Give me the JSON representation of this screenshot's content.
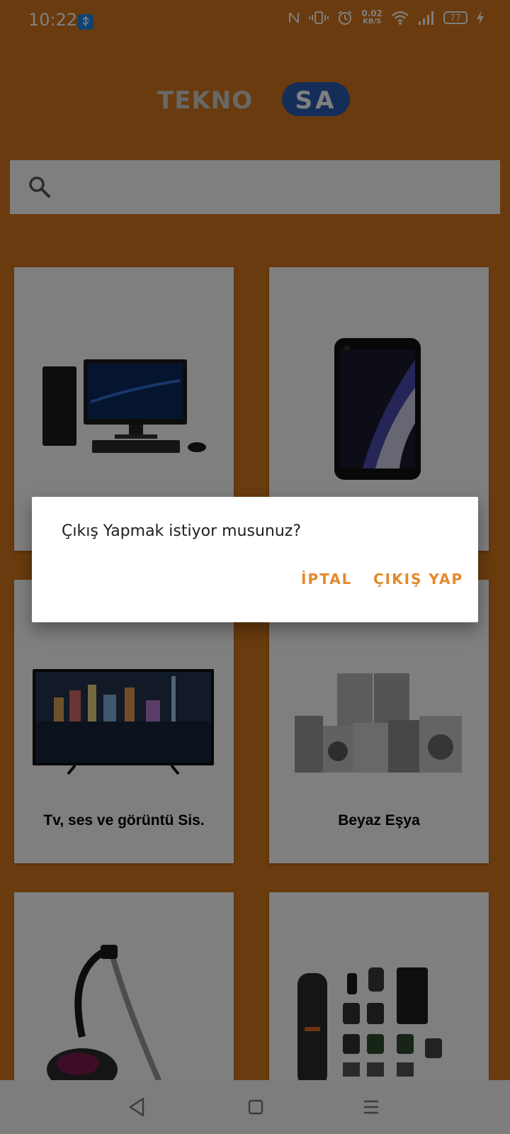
{
  "status_bar": {
    "time": "10:22",
    "net_speed_value": "0.02",
    "net_speed_unit": "KB/S",
    "battery": "77"
  },
  "header": {
    "logo_left": "TEKNO",
    "logo_right": "SA"
  },
  "search": {
    "placeholder": ""
  },
  "categories": [
    {
      "label": "",
      "icon": "desktop-computer"
    },
    {
      "label": "",
      "icon": "smartphone"
    },
    {
      "label": "Tv, ses ve görüntü Sis.",
      "icon": "television"
    },
    {
      "label": "Beyaz Eşya",
      "icon": "white-goods"
    },
    {
      "label": "",
      "icon": "vacuum-cleaner"
    },
    {
      "label": "",
      "icon": "grooming-kit"
    }
  ],
  "dialog": {
    "message": "Çıkış Yapmak istiyor musunuz?",
    "cancel_label": "İPTAL",
    "confirm_label": "ÇIKIŞ YAP"
  },
  "colors": {
    "app_background": "#d4761c",
    "accent": "#e6892b",
    "logo_blue": "#2a5cb3"
  }
}
